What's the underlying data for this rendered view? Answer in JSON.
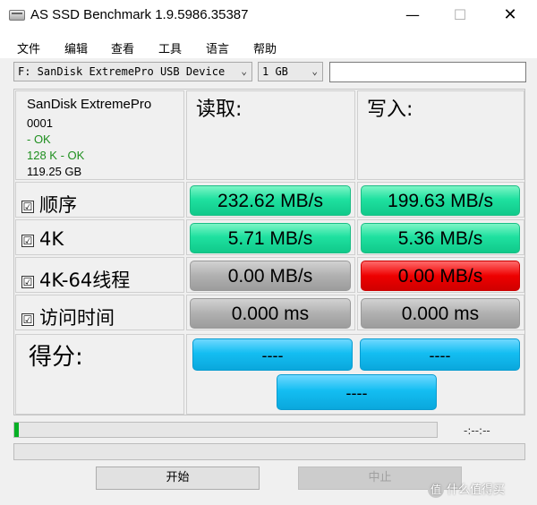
{
  "window": {
    "title": "AS SSD Benchmark 1.9.5986.35387"
  },
  "title_buttons": {
    "minimize": "—",
    "maximize": "☐",
    "close": "✕"
  },
  "menu": [
    "文件",
    "编辑",
    "查看",
    "工具",
    "语言",
    "帮助"
  ],
  "drive_select": {
    "value": "F: SanDisk ExtremePro USB Device"
  },
  "size_select": {
    "value": "1 GB"
  },
  "device_info": {
    "name": "SanDisk ExtremePro",
    "firmware": "0001",
    "status1": " - OK",
    "status2": "128 K - OK",
    "capacity": "119.25 GB"
  },
  "headers": {
    "read": "读取:",
    "write": "写入:"
  },
  "rows": [
    {
      "label": "顺序",
      "checkbox": "☑",
      "read": "232.62 MB/s",
      "write": "199.63 MB/s"
    },
    {
      "label": "4K",
      "checkbox": "☑",
      "read": "5.71 MB/s",
      "write": "5.36 MB/s"
    },
    {
      "label": "4K-64线程",
      "checkbox": "☑",
      "read": "0.00 MB/s",
      "write": "0.00 MB/s"
    },
    {
      "label": "访问时间",
      "checkbox": "☑",
      "read": "0.000 ms",
      "write": "0.000 ms"
    }
  ],
  "score": {
    "label": "得分:",
    "read": "----",
    "write": "----",
    "total": "----"
  },
  "progress": {
    "fraction": 0.01,
    "timer": "-:--:--"
  },
  "buttons": {
    "start": "开始",
    "stop": "中止"
  },
  "watermark": {
    "badge": "值",
    "text": "什么值得买"
  },
  "colors": {
    "green": "#1fe1a0",
    "gray": "#b0b0b0",
    "red": "#ee0000",
    "blue": "#14bef2",
    "progress": "#06b025"
  }
}
